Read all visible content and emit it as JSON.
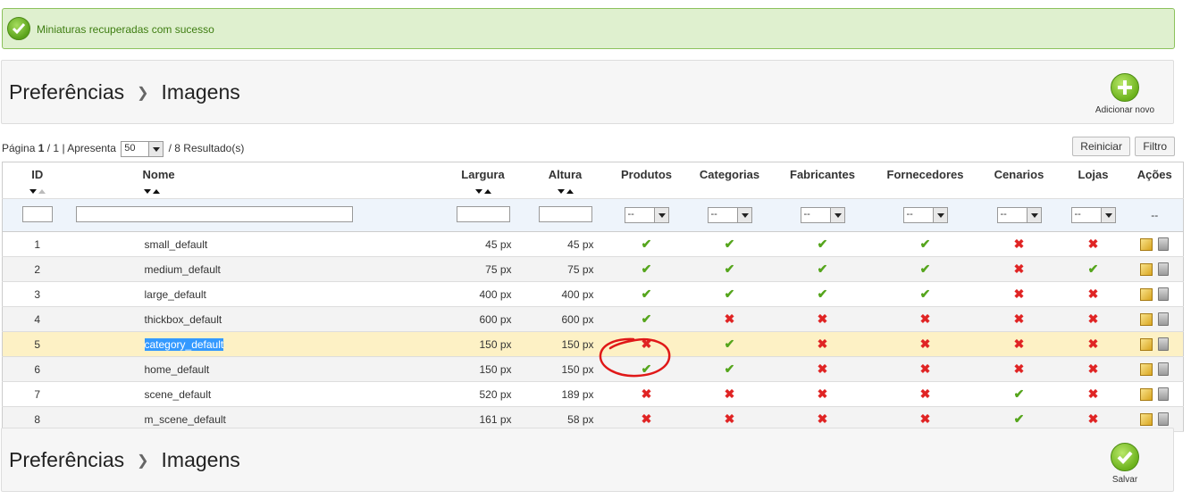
{
  "banner": {
    "message": "Miniaturas recuperadas com sucesso"
  },
  "toolbar_top": {
    "crumb1": "Preferências",
    "crumb2": "Imagens",
    "action_label": "Adicionar novo"
  },
  "toolbar_bottom": {
    "crumb1": "Preferências",
    "crumb2": "Imagens",
    "action_label": "Salvar"
  },
  "pager": {
    "prefix": "Página",
    "page": "1",
    "total_pages": "/ 1",
    "show_label": "| Apresenta",
    "per_page": "50",
    "results": "/ 8 Resultado(s)"
  },
  "buttons": {
    "reset": "Reiniciar",
    "filter": "Filtro"
  },
  "columns": {
    "id": "ID",
    "name": "Nome",
    "width": "Largura",
    "height": "Altura",
    "products": "Produtos",
    "categories": "Categorias",
    "manufacturers": "Fabricantes",
    "suppliers": "Fornecedores",
    "scenes": "Cenarios",
    "stores": "Lojas",
    "actions": "Ações"
  },
  "filters": {
    "select_value": "--",
    "actions_placeholder": "--"
  },
  "icons": {
    "check": "✔",
    "cross": "✖"
  },
  "colors": {
    "check": "#55a51c",
    "cross": "#e02424",
    "highlight": "#fdf1c5",
    "banner_bg": "#dff0cf"
  },
  "rows": [
    {
      "id": "1",
      "name": "small_default",
      "width": "45 px",
      "height": "45 px",
      "flags": [
        true,
        true,
        true,
        true,
        false,
        false
      ]
    },
    {
      "id": "2",
      "name": "medium_default",
      "width": "75 px",
      "height": "75 px",
      "flags": [
        true,
        true,
        true,
        true,
        false,
        true
      ]
    },
    {
      "id": "3",
      "name": "large_default",
      "width": "400 px",
      "height": "400 px",
      "flags": [
        true,
        true,
        true,
        true,
        false,
        false
      ]
    },
    {
      "id": "4",
      "name": "thickbox_default",
      "width": "600 px",
      "height": "600 px",
      "flags": [
        true,
        false,
        false,
        false,
        false,
        false
      ]
    },
    {
      "id": "5",
      "name": "category_default",
      "width": "150 px",
      "height": "150 px",
      "flags": [
        false,
        true,
        false,
        false,
        false,
        false
      ],
      "highlighted": true
    },
    {
      "id": "6",
      "name": "home_default",
      "width": "150 px",
      "height": "150 px",
      "flags": [
        true,
        true,
        false,
        false,
        false,
        false
      ]
    },
    {
      "id": "7",
      "name": "scene_default",
      "width": "520 px",
      "height": "189 px",
      "flags": [
        false,
        false,
        false,
        false,
        true,
        false
      ]
    },
    {
      "id": "8",
      "name": "m_scene_default",
      "width": "161 px",
      "height": "58 px",
      "flags": [
        false,
        false,
        false,
        false,
        true,
        false
      ]
    }
  ]
}
